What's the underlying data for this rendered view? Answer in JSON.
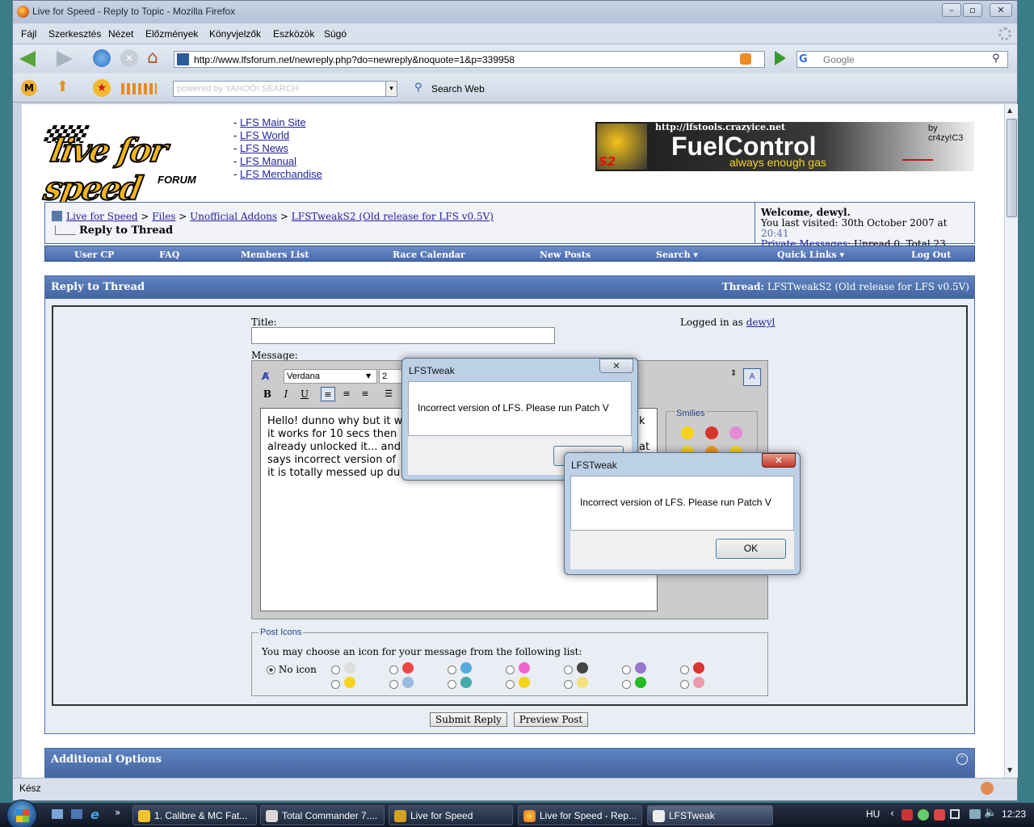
{
  "window": {
    "title": "Live for Speed - Reply to Topic - Mozilla Firefox"
  },
  "menu": [
    "Fájl",
    "Szerkesztés",
    "Nézet",
    "Előzmények",
    "Könyvjelzők",
    "Eszközök",
    "Súgó"
  ],
  "address_bar": {
    "url": "http://www.lfsforum.net/newreply.php?do=newreply&noquote=1&p=339958"
  },
  "google_search": {
    "placeholder": "Google"
  },
  "yahoo_bar": {
    "search_placeholder": "powered by YAHOO! SEARCH",
    "search_web_label": "Search Web"
  },
  "header": {
    "logo_text": "live for speed",
    "logo_sub": "FORUM",
    "site_links": [
      "LFS Main Site",
      "LFS World",
      "LFS News",
      "LFS Manual",
      "LFS Merchandise"
    ],
    "banner": {
      "url": "http://lfstools.crazyice.net",
      "credit": "by cr4zy!C3",
      "title": "FuelControl",
      "subtitle": "always enough gas",
      "badge": "S2"
    }
  },
  "breadcrumb": {
    "items": [
      "Live for Speed",
      "Files",
      "Unofficial Addons",
      "LFSTweakS2 (Old release for LFS v0.5V)"
    ],
    "current": "Reply to Thread"
  },
  "welcome": {
    "line1": "Welcome, dewyl.",
    "visited_prefix": "You last visited: 30th October 2007 at",
    "visited_time": "20:41",
    "pm_link": "Private Messages",
    "pm_status": ": Unread 0, Total 23."
  },
  "navbar": [
    "User CP",
    "FAQ",
    "Members List",
    "Race Calendar",
    "New Posts",
    "Search ▾",
    "Quick Links ▾",
    "Log Out"
  ],
  "reply_panel": {
    "heading": "Reply to Thread",
    "thread_label": "Thread:",
    "thread_name": "LFSTweakS2 (Old release for LFS v0.5V)"
  },
  "form": {
    "title_label": "Title:",
    "logged_in_label": "Logged in as",
    "logged_in_user": "dewyl",
    "message_label": "Message:",
    "font_select": "Verdana",
    "size_select": "2",
    "message_lines": [
      "Hello! dunno why but it w",
      "it works for 10 secs then",
      "already unlocked it... and",
      "says incorrect version of",
      "it is totally messed up du"
    ],
    "message_fragments": [
      "k",
      "at"
    ],
    "smilies_label": "Smilies"
  },
  "post_icons": {
    "legend": "Post Icons",
    "instruction": "You may choose an icon for your message from the following list:",
    "no_icon_label": "No icon"
  },
  "buttons": {
    "submit": "Submit Reply",
    "preview": "Preview Post"
  },
  "additional_options": {
    "heading": "Additional Options"
  },
  "dialog_back": {
    "title": "LFSTweak",
    "message": "Incorrect version of LFS. Please run Patch V",
    "ok": "OK"
  },
  "dialog_front": {
    "title": "LFSTweak",
    "message": "Incorrect version of LFS. Please run Patch V",
    "ok": "OK"
  },
  "status": {
    "text": "Kész"
  },
  "taskbar": {
    "items": [
      "1. Calibre & MC Fat...",
      "Total Commander 7....",
      "Live for Speed",
      "Live for Speed - Rep...",
      "LFSTweak"
    ],
    "lang": "HU",
    "clock": "12:23"
  },
  "colors": {
    "forum_blue": "#4a6fa8",
    "nav_blue": "#5577b6",
    "link": "#22229c",
    "visited_time": "#5b6ea0"
  }
}
